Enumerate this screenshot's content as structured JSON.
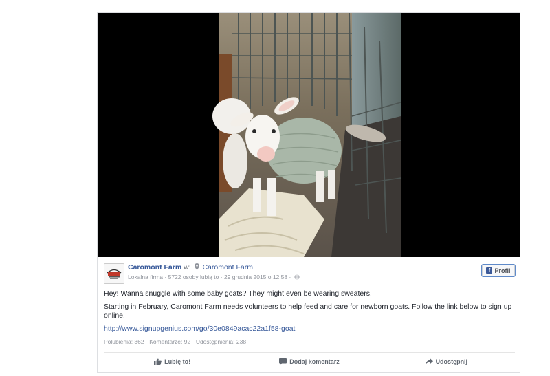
{
  "post": {
    "page_name": "Caromont Farm",
    "separator": "w:",
    "location": "Caromont Farm.",
    "category": "Lokalna firma",
    "likes_count_text": "5722 osoby lubią to",
    "date": "29 grudnia 2015 o 12:58",
    "dot": "·",
    "profile_button": "Profil",
    "text_line1": "Hey! Wanna snuggle with some baby goats? They might even be wearing sweaters.",
    "text_line2": "Starting in February, Caromont Farm needs volunteers to help feed and care for newborn goats. Follow the link below to sign up online!",
    "link": "http://www.signupgenius.com/go/30e0849acac22a1f58-goat",
    "stats": {
      "likes": "Polubienia: 362",
      "comments": "Komentarze: 92",
      "shares": "Udostępnienia: 238"
    },
    "actions": {
      "like": "Lubię to!",
      "comment": "Dodaj komentarz",
      "share": "Udostępnij"
    }
  },
  "colors": {
    "link": "#365899",
    "muted": "#90949c",
    "text": "#1d2129",
    "facebook_blue": "#3b5998"
  },
  "icons": {
    "location": "location-pin-icon",
    "globe": "globe-icon",
    "like": "thumbs-up-icon",
    "comment": "comment-icon",
    "share": "share-arrow-icon",
    "facebook": "facebook-logo-icon"
  }
}
